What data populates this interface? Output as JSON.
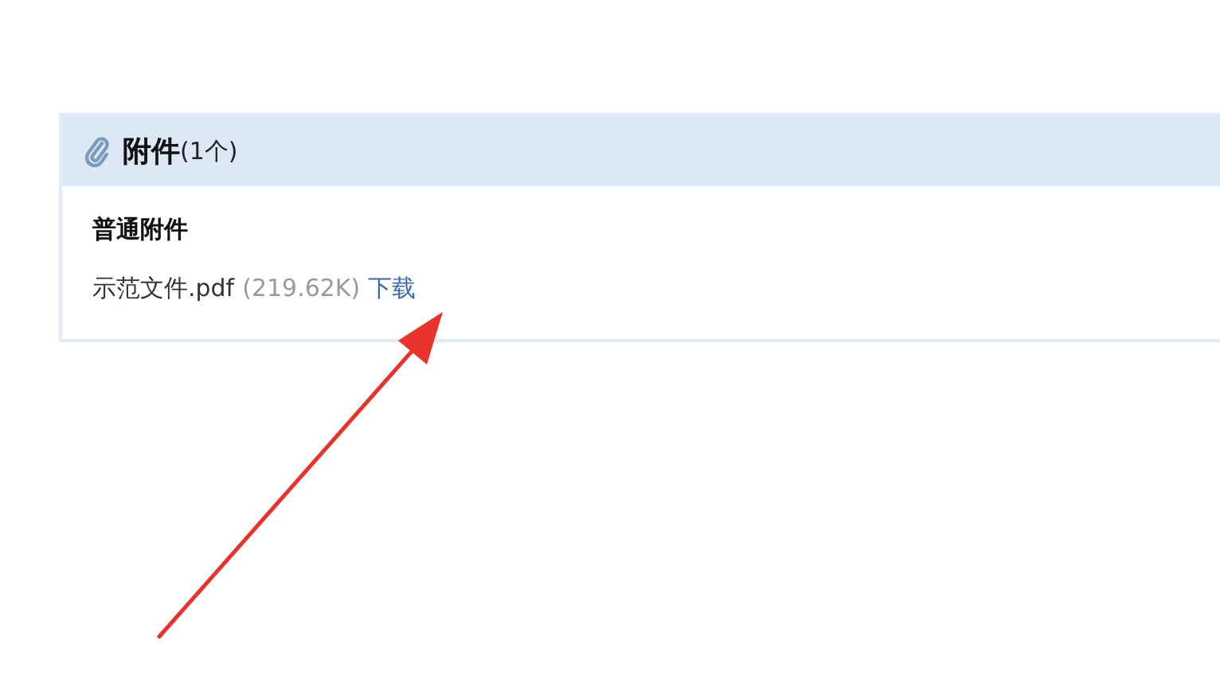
{
  "panel": {
    "title": "附件",
    "count": "(1个)"
  },
  "section": {
    "title": "普通附件"
  },
  "files": [
    {
      "name": "示范文件.pdf",
      "size": "(219.62K)",
      "link": "下载"
    }
  ]
}
